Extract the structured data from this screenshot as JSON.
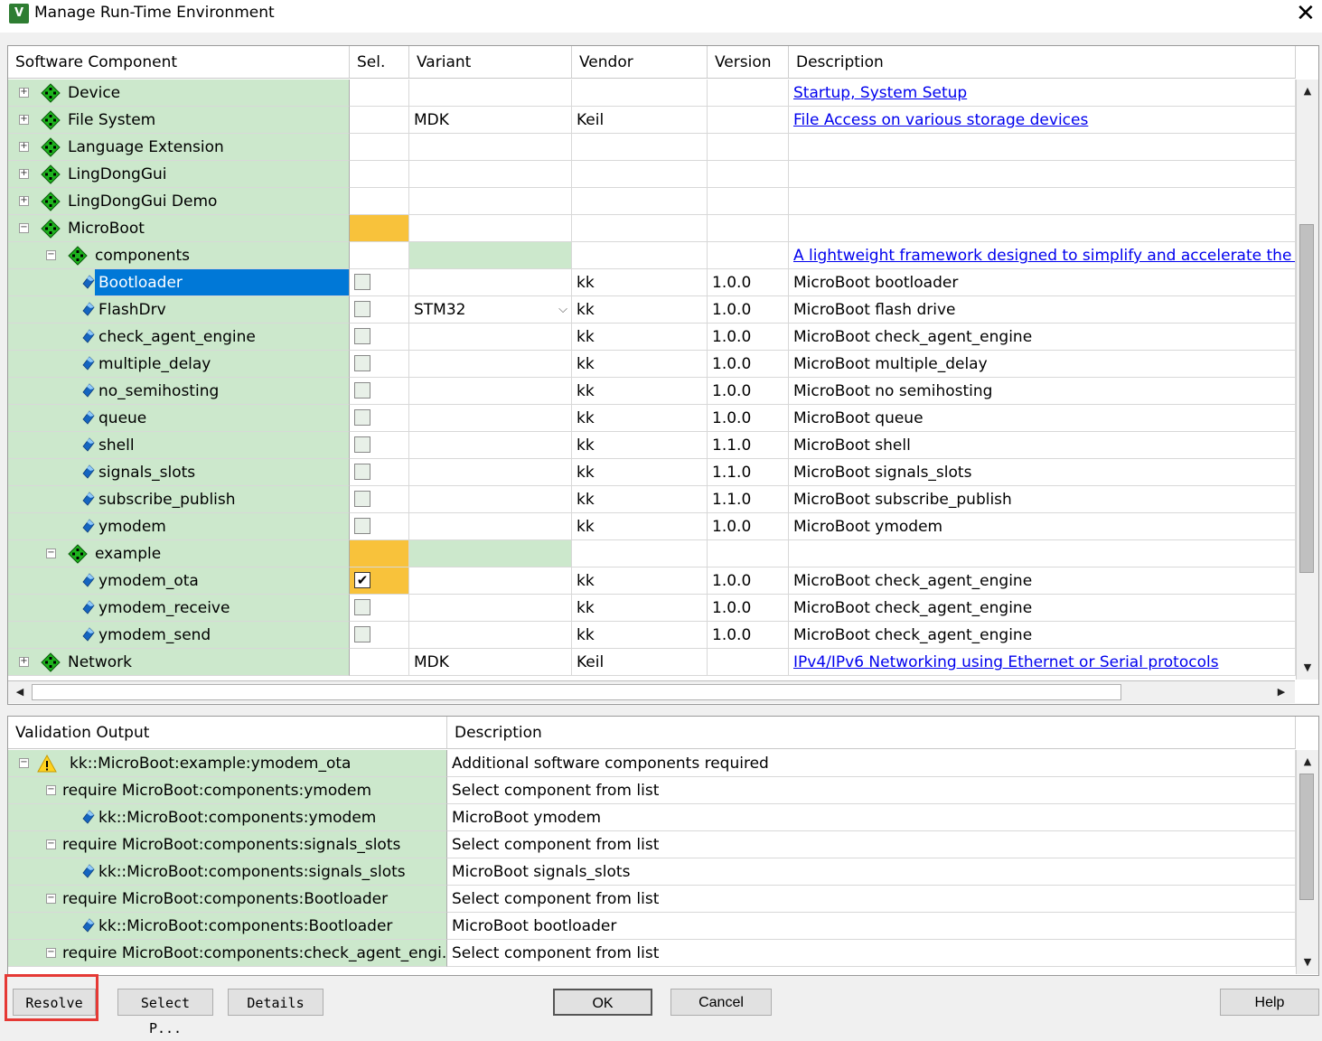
{
  "window": {
    "title": "Manage Run-Time Environment",
    "icon": "keil-uv-icon",
    "close": "✕"
  },
  "components": {
    "headers": [
      "Software Component",
      "Sel.",
      "Variant",
      "Vendor",
      "Version",
      "Description"
    ],
    "rows": [
      {
        "level": 0,
        "exp": "+",
        "icon": "green",
        "name": "Device",
        "sel": "",
        "variant": "",
        "vendor": "",
        "version": "",
        "desc": "Startup, System Setup",
        "link": true
      },
      {
        "level": 0,
        "exp": "+",
        "icon": "green",
        "name": "File System",
        "sel": "",
        "variant": "MDK",
        "vendor": "Keil",
        "version": "",
        "desc": "File Access on various storage devices",
        "link": true
      },
      {
        "level": 0,
        "exp": "+",
        "icon": "green",
        "name": "Language Extension",
        "sel": "",
        "variant": "",
        "vendor": "",
        "version": "",
        "desc": "",
        "link": false
      },
      {
        "level": 0,
        "exp": "+",
        "icon": "green",
        "name": "LingDongGui",
        "sel": "",
        "variant": "",
        "vendor": "",
        "version": "",
        "desc": "",
        "link": false
      },
      {
        "level": 0,
        "exp": "+",
        "icon": "green",
        "name": "LingDongGui Demo",
        "sel": "",
        "variant": "",
        "vendor": "",
        "version": "",
        "desc": "",
        "link": false
      },
      {
        "level": 0,
        "exp": "-",
        "icon": "green",
        "name": "MicroBoot",
        "sel": "orange",
        "variant": "",
        "vendor": "",
        "version": "",
        "desc": "",
        "link": false
      },
      {
        "level": 1,
        "exp": "-",
        "icon": "green",
        "name": "components",
        "sel": "",
        "variant": "green",
        "vendor": "",
        "version": "",
        "desc": "A lightweight framework designed to simplify and accelerate the setup",
        "link": true
      },
      {
        "level": 2,
        "exp": "",
        "icon": "blue",
        "name": "Bootloader",
        "selected": true,
        "sel": "cb",
        "variant": "",
        "vendor": "kk",
        "version": "1.0.0",
        "desc": "MicroBoot bootloader",
        "link": false
      },
      {
        "level": 2,
        "exp": "",
        "icon": "blue",
        "name": "FlashDrv",
        "sel": "cb",
        "variant": "STM32",
        "dropdown": true,
        "vendor": "kk",
        "version": "1.0.0",
        "desc": "MicroBoot flash drive",
        "link": false
      },
      {
        "level": 2,
        "exp": "",
        "icon": "blue",
        "name": "check_agent_engine",
        "sel": "cb",
        "variant": "",
        "vendor": "kk",
        "version": "1.0.0",
        "desc": "MicroBoot check_agent_engine",
        "link": false
      },
      {
        "level": 2,
        "exp": "",
        "icon": "blue",
        "name": "multiple_delay",
        "sel": "cb",
        "variant": "",
        "vendor": "kk",
        "version": "1.0.0",
        "desc": "MicroBoot multiple_delay",
        "link": false
      },
      {
        "level": 2,
        "exp": "",
        "icon": "blue",
        "name": "no_semihosting",
        "sel": "cb",
        "variant": "",
        "vendor": "kk",
        "version": "1.0.0",
        "desc": "MicroBoot no semihosting",
        "link": false
      },
      {
        "level": 2,
        "exp": "",
        "icon": "blue",
        "name": "queue",
        "sel": "cb",
        "variant": "",
        "vendor": "kk",
        "version": "1.0.0",
        "desc": "MicroBoot queue",
        "link": false
      },
      {
        "level": 2,
        "exp": "",
        "icon": "blue",
        "name": "shell",
        "sel": "cb",
        "variant": "",
        "vendor": "kk",
        "version": "1.1.0",
        "desc": "MicroBoot shell",
        "link": false
      },
      {
        "level": 2,
        "exp": "",
        "icon": "blue",
        "name": "signals_slots",
        "sel": "cb",
        "variant": "",
        "vendor": "kk",
        "version": "1.1.0",
        "desc": "MicroBoot signals_slots",
        "link": false
      },
      {
        "level": 2,
        "exp": "",
        "icon": "blue",
        "name": "subscribe_publish",
        "sel": "cb",
        "variant": "",
        "vendor": "kk",
        "version": "1.1.0",
        "desc": "MicroBoot subscribe_publish",
        "link": false
      },
      {
        "level": 2,
        "exp": "",
        "icon": "blue",
        "name": "ymodem",
        "sel": "cb",
        "variant": "",
        "vendor": "kk",
        "version": "1.0.0",
        "desc": "MicroBoot ymodem",
        "link": false
      },
      {
        "level": 1,
        "exp": "-",
        "icon": "green",
        "name": "example",
        "sel": "orange",
        "variant": "green",
        "vendor": "",
        "version": "",
        "desc": "",
        "link": false
      },
      {
        "level": 2,
        "exp": "",
        "icon": "blue",
        "name": "ymodem_ota",
        "sel": "cb-checked",
        "variant": "",
        "vendor": "kk",
        "version": "1.0.0",
        "desc": "MicroBoot check_agent_engine",
        "link": false
      },
      {
        "level": 2,
        "exp": "",
        "icon": "blue",
        "name": "ymodem_receive",
        "sel": "cb",
        "variant": "",
        "vendor": "kk",
        "version": "1.0.0",
        "desc": "MicroBoot check_agent_engine",
        "link": false
      },
      {
        "level": 2,
        "exp": "",
        "icon": "blue",
        "name": "ymodem_send",
        "sel": "cb",
        "variant": "",
        "vendor": "kk",
        "version": "1.0.0",
        "desc": "MicroBoot check_agent_engine",
        "link": false
      },
      {
        "level": 0,
        "exp": "+",
        "icon": "green",
        "name": "Network",
        "sel": "",
        "variant": "MDK",
        "vendor": "Keil",
        "version": "",
        "desc": "IPv4/IPv6 Networking using Ethernet or Serial protocols",
        "link": true
      }
    ]
  },
  "validation": {
    "headers": [
      "Validation Output",
      "Description"
    ],
    "rows": [
      {
        "level": 0,
        "exp": "-",
        "icon": "warning",
        "name": "kk::MicroBoot:example:ymodem_ota",
        "desc": "Additional software components required"
      },
      {
        "level": 1,
        "exp": "-",
        "icon": "",
        "name": "require MicroBoot:components:ymodem",
        "desc": "Select component from list"
      },
      {
        "level": 2,
        "exp": "",
        "icon": "blue",
        "name": "kk::MicroBoot:components:ymodem",
        "desc": "MicroBoot ymodem"
      },
      {
        "level": 1,
        "exp": "-",
        "icon": "",
        "name": "require MicroBoot:components:signals_slots",
        "desc": "Select component from list"
      },
      {
        "level": 2,
        "exp": "",
        "icon": "blue",
        "name": "kk::MicroBoot:components:signals_slots",
        "desc": "MicroBoot signals_slots"
      },
      {
        "level": 1,
        "exp": "-",
        "icon": "",
        "name": "require MicroBoot:components:Bootloader",
        "desc": "Select component from list"
      },
      {
        "level": 2,
        "exp": "",
        "icon": "blue",
        "name": "kk::MicroBoot:components:Bootloader",
        "desc": "MicroBoot bootloader"
      },
      {
        "level": 1,
        "exp": "-",
        "icon": "",
        "name": "require MicroBoot:components:check_agent_engi...",
        "desc": "Select component from list"
      }
    ]
  },
  "buttons": {
    "resolve": "Resolve",
    "select_packs": "Select P...",
    "details": "Details",
    "ok": "OK",
    "cancel": "Cancel",
    "help": "Help"
  },
  "colors": {
    "tree_bg": "#cce8cc",
    "orange": "#f8c23b",
    "selection": "#0078d7",
    "link": "#0000ee",
    "highlight_box": "#e53935"
  }
}
